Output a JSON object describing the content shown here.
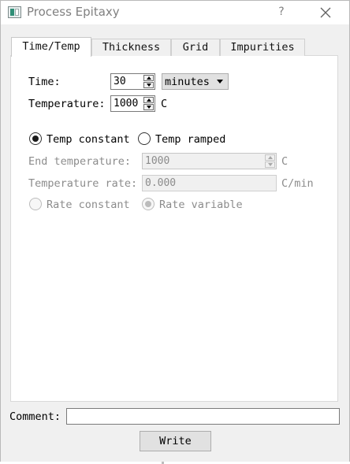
{
  "window": {
    "title": "Process Epitaxy",
    "help_label": "?"
  },
  "tabs": [
    {
      "label": "Time/Temp",
      "active": true
    },
    {
      "label": "Thickness",
      "active": false
    },
    {
      "label": "Grid",
      "active": false
    },
    {
      "label": "Impurities",
      "active": false
    }
  ],
  "time": {
    "label": "Time:",
    "value": "30",
    "unit_selected": "minutes"
  },
  "temperature": {
    "label": "Temperature:",
    "value": "1000",
    "unit": "C"
  },
  "mode": {
    "temp_constant_label": "Temp constant",
    "temp_constant_checked": true,
    "temp_ramped_label": "Temp ramped",
    "temp_ramped_checked": false
  },
  "end_temperature": {
    "label": "End temperature:",
    "value": "1000",
    "unit": "C",
    "enabled": false
  },
  "temperature_rate": {
    "label": "Temperature rate:",
    "value": "0.000",
    "unit": "C/min",
    "enabled": false
  },
  "rate_mode": {
    "rate_constant_label": "Rate constant",
    "rate_constant_checked": false,
    "rate_variable_label": "Rate variable",
    "rate_variable_checked": true,
    "enabled": false
  },
  "comment": {
    "label": "Comment:",
    "value": ""
  },
  "write_button": {
    "label": "Write"
  }
}
